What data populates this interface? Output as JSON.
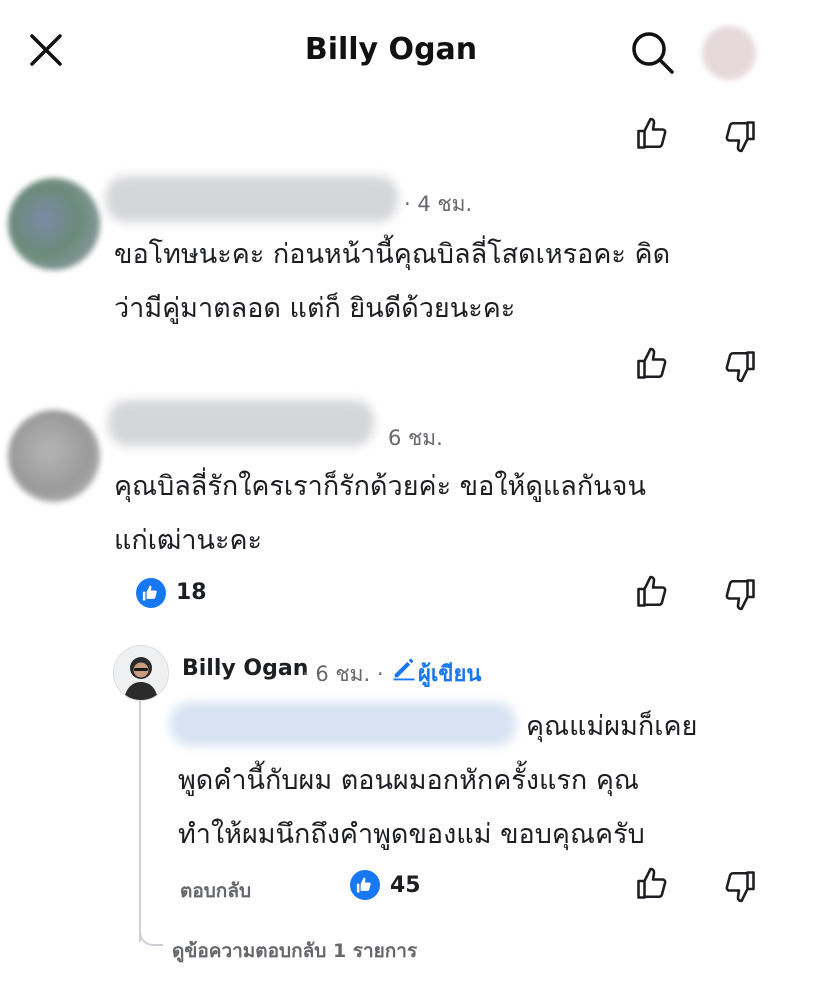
{
  "header": {
    "title": "Billy Ogan",
    "close_icon": "close-icon",
    "search_icon": "search-icon",
    "avatar_icon": "profile-avatar"
  },
  "comments": [
    {
      "time": "· 4 ชม.",
      "text_line1": "ขอโทษนะคะ ก่อนหน้านี้คุณบิลลี่โสดเหรอคะ คิด",
      "text_line2": "ว่ามีคู่มาตลอด แต่ก็ ยินดีด้วยนะคะ"
    },
    {
      "time": "6 ชม.",
      "text_line1": "คุณบิลลี่รักใครเราก็รักด้วยค่ะ ขอให้ดูแลกันจน",
      "text_line2": "แก่เฒ่านะคะ",
      "likes": "18"
    }
  ],
  "reply": {
    "author": "Billy Ogan",
    "time": "· 6 ชม. ·",
    "author_badge": "ผู้เขียน",
    "text_line1": "คุณแม่ผมก็เคย",
    "text_line2": "พูดคำนี้กับผม ตอนผมอกหักครั้งแรก คุณ",
    "text_line3": "ทำให้ผมนึกถึงคำพูดของแม่ ขอบคุณครับ",
    "reply_label": "ตอบกลับ",
    "likes": "45",
    "view_replies": "ดูข้อความตอบกลับ 1 รายการ"
  },
  "colors": {
    "accent": "#1877f2",
    "meta": "#65676b"
  }
}
